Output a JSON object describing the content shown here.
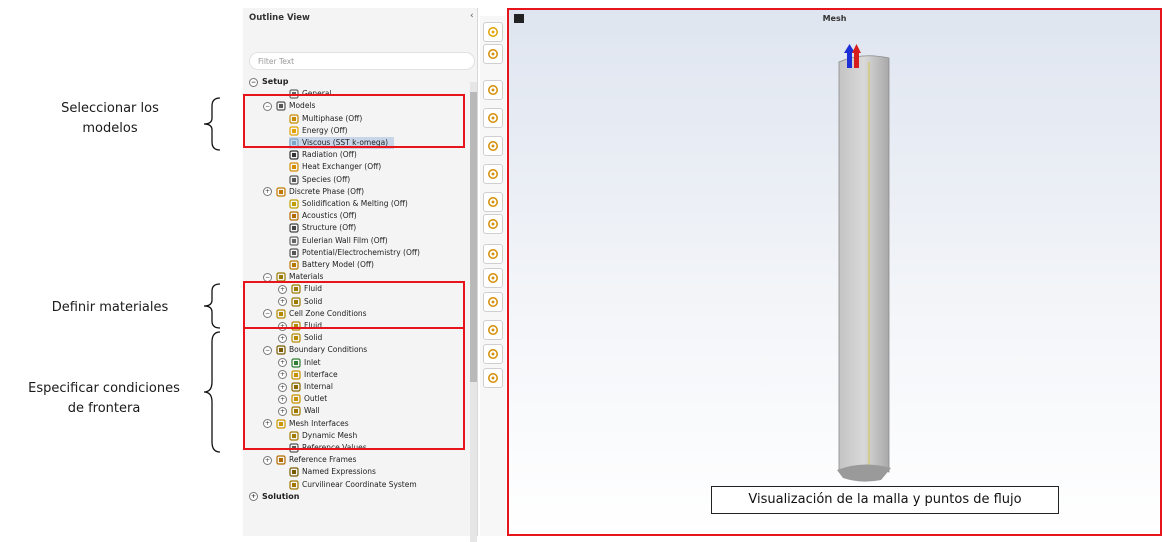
{
  "annotations": {
    "models_line1": "Seleccionar los",
    "models_line2": "modelos",
    "materials": "Definir materiales",
    "conditions_line1": "Especificar condiciones",
    "conditions_line2": "de frontera"
  },
  "outline": {
    "title": "Outline View",
    "collapse_icon": "chevron-left-icon",
    "filter_placeholder": "Filter Text",
    "items": [
      {
        "label": "Setup",
        "level": 0,
        "toggle": "−",
        "icon": "",
        "bold": true
      },
      {
        "label": "General",
        "level": 2,
        "toggle": "",
        "icon": "general-icon"
      },
      {
        "label": "Models",
        "level": 1,
        "toggle": "−",
        "icon": "models-icon"
      },
      {
        "label": "Multiphase (Off)",
        "level": 2,
        "toggle": "",
        "icon": "multiphase-icon"
      },
      {
        "label": "Energy (Off)",
        "level": 2,
        "toggle": "",
        "icon": "energy-icon"
      },
      {
        "label": "Viscous (SST k-omega)",
        "level": 2,
        "toggle": "",
        "icon": "viscous-icon",
        "selected": true
      },
      {
        "label": "Radiation (Off)",
        "level": 2,
        "toggle": "",
        "icon": "radiation-icon"
      },
      {
        "label": "Heat Exchanger (Off)",
        "level": 2,
        "toggle": "",
        "icon": "heat-exchanger-icon"
      },
      {
        "label": "Species (Off)",
        "level": 2,
        "toggle": "",
        "icon": "species-icon"
      },
      {
        "label": "Discrete Phase (Off)",
        "level": 1,
        "toggle": "+",
        "icon": "discrete-phase-icon"
      },
      {
        "label": "Solidification & Melting (Off)",
        "level": 2,
        "toggle": "",
        "icon": "solidification-icon"
      },
      {
        "label": "Acoustics (Off)",
        "level": 2,
        "toggle": "",
        "icon": "acoustics-icon"
      },
      {
        "label": "Structure (Off)",
        "level": 2,
        "toggle": "",
        "icon": "structure-icon"
      },
      {
        "label": "Eulerian Wall Film (Off)",
        "level": 2,
        "toggle": "",
        "icon": "wall-film-icon"
      },
      {
        "label": "Potential/Electrochemistry (Off)",
        "level": 2,
        "toggle": "",
        "icon": "potential-icon"
      },
      {
        "label": "Battery Model (Off)",
        "level": 2,
        "toggle": "",
        "icon": "battery-icon"
      },
      {
        "label": "Materials",
        "level": 1,
        "toggle": "−",
        "icon": "materials-icon"
      },
      {
        "label": "Fluid",
        "level": 2,
        "toggle": "+",
        "icon": "materials-icon"
      },
      {
        "label": "Solid",
        "level": 2,
        "toggle": "+",
        "icon": "materials-icon"
      },
      {
        "label": "Cell Zone Conditions",
        "level": 1,
        "toggle": "−",
        "icon": "zone-icon"
      },
      {
        "label": "Fluid",
        "level": 2,
        "toggle": "+",
        "icon": "zone-icon"
      },
      {
        "label": "Solid",
        "level": 2,
        "toggle": "+",
        "icon": "zone-icon"
      },
      {
        "label": "Boundary Conditions",
        "level": 1,
        "toggle": "−",
        "icon": "boundary-icon"
      },
      {
        "label": "Inlet",
        "level": 2,
        "toggle": "+",
        "icon": "inlet-icon"
      },
      {
        "label": "Interface",
        "level": 2,
        "toggle": "+",
        "icon": "interface-icon"
      },
      {
        "label": "Internal",
        "level": 2,
        "toggle": "+",
        "icon": "internal-icon"
      },
      {
        "label": "Outlet",
        "level": 2,
        "toggle": "+",
        "icon": "outlet-icon"
      },
      {
        "label": "Wall",
        "level": 2,
        "toggle": "+",
        "icon": "wall-icon"
      },
      {
        "label": "Mesh Interfaces",
        "level": 1,
        "toggle": "+",
        "icon": "mesh-interfaces-icon"
      },
      {
        "label": "Dynamic Mesh",
        "level": 2,
        "toggle": "",
        "icon": "dynamic-mesh-icon"
      },
      {
        "label": "Reference Values",
        "level": 2,
        "toggle": "",
        "icon": "reference-values-icon"
      },
      {
        "label": "Reference Frames",
        "level": 1,
        "toggle": "+",
        "icon": "reference-frames-icon"
      },
      {
        "label": "Named Expressions",
        "level": 2,
        "toggle": "",
        "icon": "named-expressions-icon"
      },
      {
        "label": "Curvilinear Coordinate System",
        "level": 2,
        "toggle": "",
        "icon": "curvilinear-icon"
      },
      {
        "label": "Solution",
        "level": 0,
        "toggle": "+",
        "icon": "",
        "bold": true
      }
    ]
  },
  "toolbar": {
    "buttons": [
      "display-options-icon",
      "view-cube-icon",
      "select-pointer-icon",
      "rotate-icon",
      "pan-icon",
      "zoom-in-box-icon",
      "zoom-to-fit-icon",
      "probe-icon",
      "clipping-plane-icon",
      "zoom-in-icon",
      "zoom-out-icon",
      "magnify-icon",
      "axes-icon",
      "lock-icon"
    ]
  },
  "viewport": {
    "title": "Mesh",
    "caption": "Visualización de la malla y puntos de flujo"
  },
  "colors": {
    "highlight": "#e8141c",
    "selected": "#c9d6ea",
    "mesh": "#b9b9b9"
  }
}
